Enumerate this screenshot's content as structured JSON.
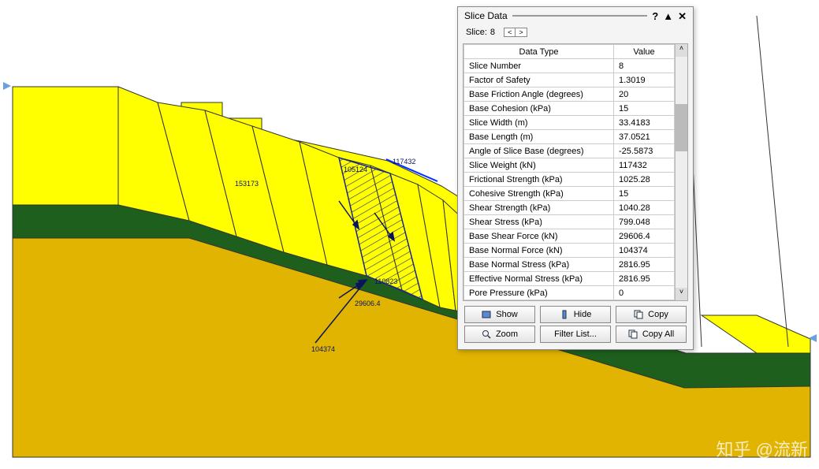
{
  "panel": {
    "title": "Slice Data",
    "slice_label": "Slice:",
    "slice_value": "8",
    "headers": {
      "col1": "Data Type",
      "col2": "Value"
    },
    "rows": [
      {
        "name": "Slice Number",
        "value": "8"
      },
      {
        "name": "Factor of Safety",
        "value": "1.3019"
      },
      {
        "name": "Base Friction Angle (degrees)",
        "value": "20"
      },
      {
        "name": "Base Cohesion (kPa)",
        "value": "15"
      },
      {
        "name": "Slice Width (m)",
        "value": "33.4183"
      },
      {
        "name": "Base Length (m)",
        "value": "37.0521"
      },
      {
        "name": "Angle of Slice Base (degrees)",
        "value": "-25.5873"
      },
      {
        "name": "Slice Weight (kN)",
        "value": "117432"
      },
      {
        "name": "Frictional Strength (kPa)",
        "value": "1025.28"
      },
      {
        "name": "Cohesive Strength (kPa)",
        "value": "15"
      },
      {
        "name": "Shear Strength (kPa)",
        "value": "1040.28"
      },
      {
        "name": "Shear Stress (kPa)",
        "value": "799.048"
      },
      {
        "name": "Base Shear Force (kN)",
        "value": "29606.4"
      },
      {
        "name": "Base Normal Force (kN)",
        "value": "104374"
      },
      {
        "name": "Base Normal Stress (kPa)",
        "value": "2816.95"
      },
      {
        "name": "Effective Normal Stress (kPa)",
        "value": "2816.95"
      },
      {
        "name": "Pore Pressure (kPa)",
        "value": "0"
      }
    ],
    "buttons": {
      "show": "Show",
      "hide": "Hide",
      "copy": "Copy",
      "zoom": "Zoom",
      "filter": "Filter List...",
      "copy_all": "Copy All"
    }
  },
  "annotations": {
    "a1": "117432",
    "a2": "105124",
    "a3": "153173",
    "a4": "110823",
    "a5": "29606.4",
    "a6": "104374"
  },
  "colors": {
    "layer1": "#ffff00",
    "layer2": "#e0b400",
    "layer3": "#1e5f1e"
  },
  "watermark": "知乎 @流新"
}
